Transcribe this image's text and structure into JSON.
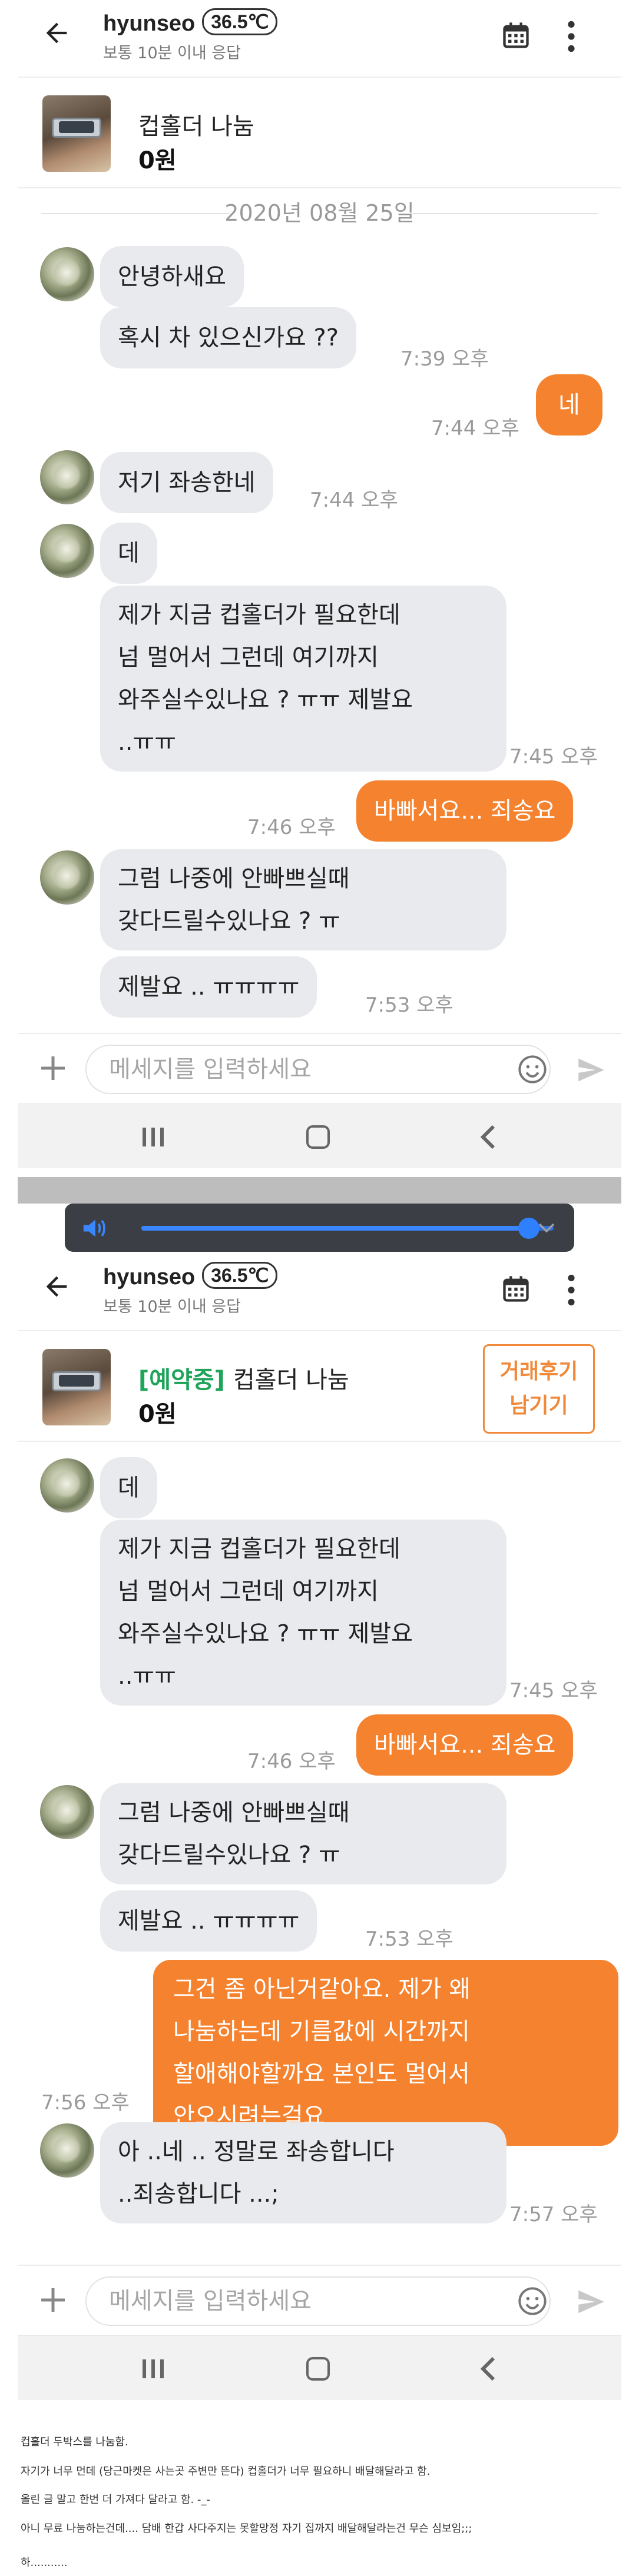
{
  "header": {
    "user_name": "hyunseo",
    "temperature": "36.5℃",
    "response_time": "보통 10분 이내 응답"
  },
  "product": {
    "title": "컵홀더 나눔",
    "price": "0원",
    "status": "[예약중]",
    "review_button": [
      "거래후기",
      "남기기"
    ]
  },
  "date_separator": "2020년 08월 25일",
  "input_placeholder": "메세지를 입력하세요",
  "colors": {
    "accent": "#f5822e",
    "reserved": "#1fa45a",
    "bubble_in": "#e8eaed"
  },
  "icons": [
    "back-arrow-icon",
    "calendar-icon",
    "more-vertical-icon",
    "plus-icon",
    "emoji-icon",
    "send-icon",
    "volume-icon",
    "chevron-down-icon"
  ],
  "volume_level": 0.94,
  "screen1_messages": [
    {
      "dir": "in",
      "text": "안녕하새요",
      "time": ""
    },
    {
      "dir": "in",
      "text": "혹시 차 있으신가요 ??",
      "time": "7:39 오후"
    },
    {
      "dir": "out",
      "text": "네",
      "time": "7:44 오후"
    },
    {
      "dir": "in",
      "text": "저기 좌송한네",
      "time": "7:44 오후"
    },
    {
      "dir": "in",
      "text": "데",
      "time": ""
    },
    {
      "dir": "in",
      "lines": [
        "제가 지금 컵홀더가 필요한데",
        "넘 멀어서  그런데 여기까지",
        "와주실수있나요 ? ㅠㅠ 제발요",
        "..ㅠㅠ"
      ],
      "time": "7:45 오후"
    },
    {
      "dir": "out",
      "text": "바빠서요... 죄송요",
      "time": "7:46 오후"
    },
    {
      "dir": "in",
      "lines": [
        "그럼 나중에 안빠쁘실때",
        "갖다드릴수있나요 ? ㅠ"
      ],
      "time": ""
    },
    {
      "dir": "in",
      "text": "제발요 .. ㅠㅠㅠㅠ",
      "time": "7:53 오후"
    }
  ],
  "screen2_messages": [
    {
      "dir": "in",
      "text": "데",
      "time": ""
    },
    {
      "dir": "in",
      "lines": [
        "제가 지금 컵홀더가 필요한데",
        "넘 멀어서  그런데 여기까지",
        "와주실수있나요 ? ㅠㅠ 제발요",
        "..ㅠㅠ"
      ],
      "time": "7:45 오후"
    },
    {
      "dir": "out",
      "text": "바빠서요... 죄송요",
      "time": "7:46 오후"
    },
    {
      "dir": "in",
      "lines": [
        "그럼 나중에 안빠쁘실때",
        "갖다드릴수있나요 ? ㅠ"
      ],
      "time": ""
    },
    {
      "dir": "in",
      "text": "제발요 .. ㅠㅠㅠㅠ",
      "time": "7:53 오후"
    },
    {
      "dir": "out",
      "lines": [
        "그건 좀 아닌거같아요. 제가 왜",
        "나눔하는데 기름값에 시간까지",
        "할애해야할까요 본인도 멀어서",
        "안오시려는걸요"
      ],
      "time": "7:56 오후"
    },
    {
      "dir": "in",
      "lines": [
        "아 ..네 .. 정말로 좌송합니다",
        "..죄송합니다 ...;"
      ],
      "time": "7:57 오후"
    }
  ],
  "caption": [
    "컵홀더 두박스를 나눔함.",
    "자기가 너무 먼데 (당근마켓은 사는곳 주변만 뜬다) 컵홀더가 너무 필요하니 배달해달라고 함.",
    "올린 글 말고 한번 더 가져다 달라고 함.  -_-",
    "아니 무료 나눔하는건데....   담배 한갑 사다주지는 못할망정 자기 집까지 배달해달라는건 무슨 심보임;;;",
    "하..........."
  ]
}
